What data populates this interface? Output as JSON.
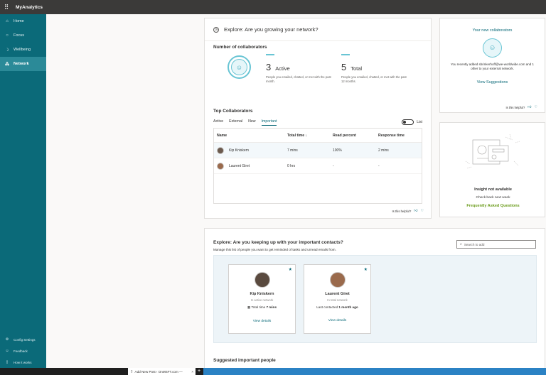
{
  "app": {
    "title": "MyAnalytics",
    "waffle_icon": "waffle-icon"
  },
  "sidebar": {
    "items": [
      {
        "label": "Home",
        "icon": "home-icon"
      },
      {
        "label": "Focus",
        "icon": "lightbulb-icon"
      },
      {
        "label": "Wellbeing",
        "icon": "moon-icon"
      },
      {
        "label": "Network",
        "icon": "network-icon",
        "active": true
      }
    ],
    "bottom": [
      {
        "label": "Config Settings",
        "icon": "settings-icon"
      },
      {
        "label": "Feedback",
        "icon": "feedback-icon"
      },
      {
        "label": "How it works",
        "icon": "book-icon"
      }
    ]
  },
  "network_card": {
    "title": "Explore: Are you growing your network?",
    "collab_title": "Number of collaborators",
    "active": {
      "num": "3",
      "label": "Active",
      "desc": "People you emailed, chatted, or met with the past month."
    },
    "total": {
      "num": "5",
      "label": "Total",
      "desc": "People you emailed, chatted, or met with the past 12 months."
    },
    "top_title": "Top Collaborators",
    "tabs": [
      "Active",
      "External",
      "New",
      "Important"
    ],
    "active_tab": "Important",
    "toggle_label": "List",
    "table": {
      "headers": [
        "Name",
        "Total time ↓",
        "Read percent",
        "Response time"
      ],
      "rows": [
        [
          "Kip Kniskern",
          "7 mins",
          "100%",
          "2 mins"
        ],
        [
          "Laurent Giret",
          "0 hrs",
          "-",
          "-"
        ]
      ]
    },
    "helpful": "Is this helpful?"
  },
  "new_collab_card": {
    "title": "Your new collaborators",
    "text": "You recently added sbrinkerhoff@we-worldwide.com and 1 other to your external network.",
    "link": "View Suggestions",
    "helpful": "Is this helpful?"
  },
  "insight_card": {
    "title": "Insight not available",
    "sub": "Check back next week",
    "link": "Frequently Asked Questions"
  },
  "contacts_card": {
    "title": "Explore: Are you keeping up with your important contacts?",
    "subtitle": "Manage this list of people you want to get reminded of tasks and unread emails from.",
    "search_placeholder": "Search to add",
    "contacts": [
      {
        "name": "Kip Kniskern",
        "network": "In active network",
        "info_label": "Total time",
        "info_value": "7 mins",
        "link": "View details"
      },
      {
        "name": "Laurent Giret",
        "network": "In total network",
        "info_label": "Last contacted",
        "info_value": "1 month ago",
        "link": "View details"
      }
    ],
    "bottom_title": "Suggested important people"
  },
  "taskbar": {
    "tab_label": "Add New Post ‹ OnMSFT.com —",
    "close": "×",
    "plus": "+"
  },
  "colors": {
    "accent": "#0b6a79",
    "sidebar": "#0b6a79",
    "topbar": "#3b3a39",
    "link_green": "#6a9b1a"
  }
}
